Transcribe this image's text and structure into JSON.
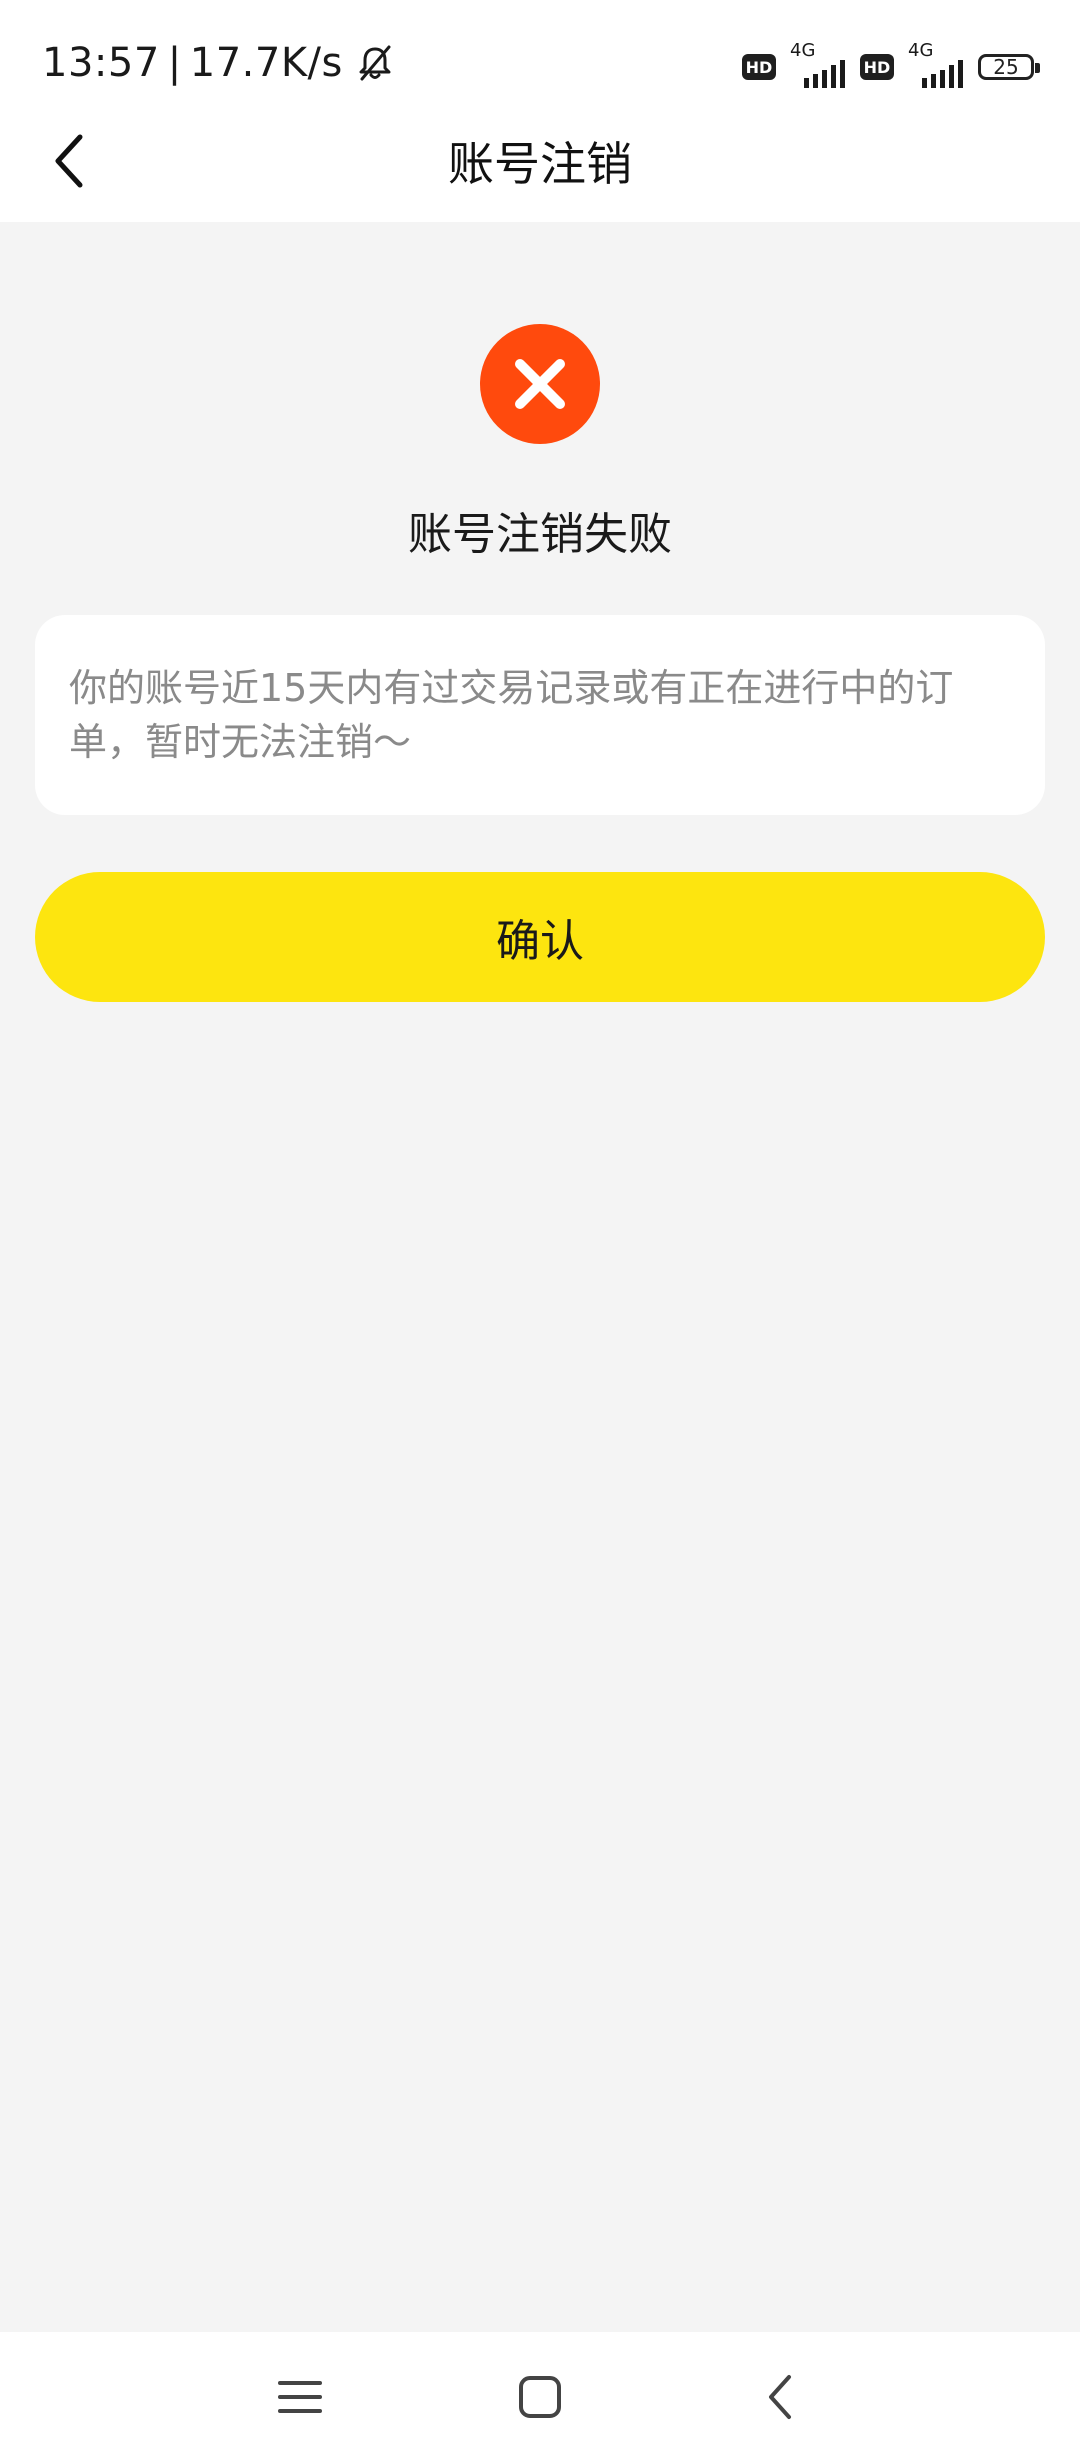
{
  "status_bar": {
    "time": "13:57",
    "separator": "|",
    "net_speed": "17.7K/s",
    "sim1_badge": "HD",
    "sim1_network": "4G",
    "sim2_badge": "HD",
    "sim2_network": "4G",
    "battery": "25"
  },
  "header": {
    "title": "账号注销"
  },
  "main": {
    "result_title": "账号注销失败",
    "message": "你的账号近15天内有过交易记录或有正在进行中的订单，暂时无法注销～",
    "confirm_label": "确认"
  },
  "colors": {
    "accent": "#fde50f",
    "error": "#ff4a0d",
    "background": "#f4f4f4"
  },
  "icons": {
    "back": "chevron-left-icon",
    "fail": "close-icon",
    "mute": "bell-off-icon",
    "menu": "menu-icon",
    "home": "home-icon",
    "nav_back": "nav-back-icon"
  }
}
